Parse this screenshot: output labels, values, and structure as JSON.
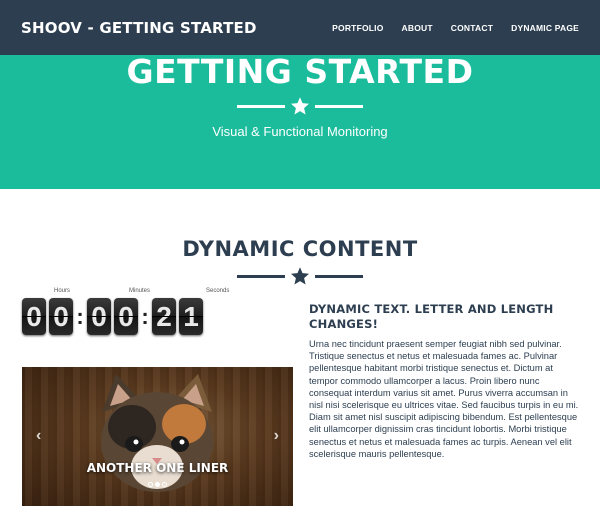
{
  "navbar": {
    "brand": "SHOOV - GETTING STARTED",
    "items": [
      "PORTFOLIO",
      "ABOUT",
      "CONTACT",
      "DYNAMIC PAGE"
    ]
  },
  "header": {
    "title": "GETTING STARTED",
    "subtitle": "Visual & Functional Monitoring"
  },
  "section": {
    "title": "DYNAMIC CONTENT"
  },
  "countdown": {
    "labels": [
      "Hours",
      "Minutes",
      "Seconds"
    ],
    "digits": [
      "0",
      "0",
      "0",
      "0",
      "2",
      "1"
    ]
  },
  "carousel": {
    "caption": "ANOTHER ONE LINER",
    "slides": 3,
    "active_slide": 2
  },
  "text": {
    "title": "DYNAMIC TEXT. LETTER AND LENGTH CHANGES!",
    "body": "Urna nec tincidunt praesent semper feugiat nibh sed pulvinar. Tristique senectus et netus et malesuada fames ac. Pulvinar pellentesque habitant morbi tristique senectus et. Dictum at tempor commodo ullamcorper a lacus. Proin libero nunc consequat interdum varius sit amet. Purus viverra accumsan in nisl nisi scelerisque eu ultrices vitae. Sed faucibus turpis in eu mi. Diam sit amet nisl suscipit adipiscing bibendum. Est pellentesque elit ullamcorper dignissim cras tincidunt lobortis. Morbi tristique senectus et netus et malesuada fames ac turpis. Aenean vel elit scelerisque mauris pellentesque."
  },
  "colors": {
    "navbar": "#2c3e50",
    "header": "#1abc9c",
    "text": "#2c3e50"
  },
  "icons": [
    "star-icon",
    "chevron-left-icon",
    "chevron-right-icon"
  ]
}
